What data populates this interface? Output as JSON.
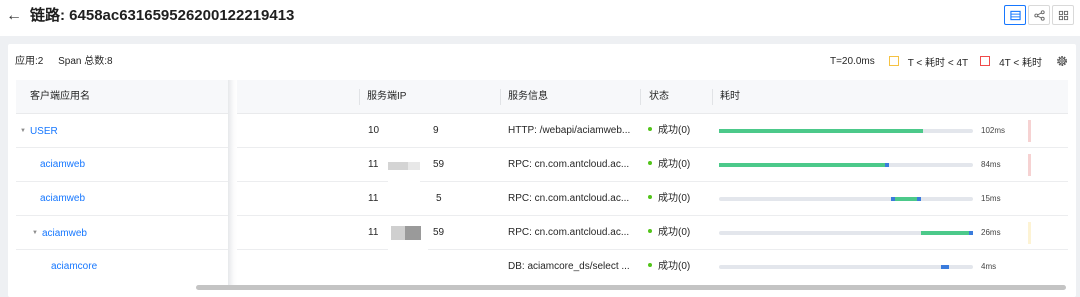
{
  "header": {
    "back_icon": "arrow-left-icon",
    "title": "链路: 6458ac631659526200122219413",
    "view_buttons": [
      {
        "icon": "table-view-icon",
        "active": true
      },
      {
        "icon": "graph-view-icon",
        "active": false
      },
      {
        "icon": "grid-view-icon",
        "active": false
      }
    ]
  },
  "summary": {
    "apps": "应用:2",
    "span_count": "Span 总数:8"
  },
  "legend": {
    "t_value": "T=20.0ms",
    "warn_label": "T < 耗时 < 4T",
    "warn_color": "#f5c242",
    "alert_label": "4T < 耗时",
    "alert_color": "#f04a4a",
    "settings_icon": "gear-icon"
  },
  "table": {
    "columns": [
      "客户端应用名",
      "服务端IP",
      "服务信息",
      "状态",
      "耗时"
    ],
    "rows": [
      {
        "app": "USER",
        "expandable": true,
        "indent": 0,
        "ip_prefix": "10",
        "ip_suffix": "9",
        "service": "HTTP: /webapi/aciamweb...",
        "status": "成功(0)",
        "duration": "102ms"
      },
      {
        "app": "aciamweb",
        "expandable": false,
        "indent": 1,
        "ip_prefix": "11",
        "ip_suffix": "59",
        "service": "RPC: cn.com.antcloud.ac...",
        "status": "成功(0)",
        "duration": "84ms"
      },
      {
        "app": "aciamweb",
        "expandable": false,
        "indent": 1,
        "ip_prefix": "11",
        "ip_suffix": "5",
        "service": "RPC: cn.com.antcloud.ac...",
        "status": "成功(0)",
        "duration": "15ms"
      },
      {
        "app": "aciamweb",
        "expandable": true,
        "indent": 1,
        "ip_prefix": "11",
        "ip_suffix": "59",
        "service": "RPC: cn.com.antcloud.ac...",
        "status": "成功(0)",
        "duration": "26ms"
      },
      {
        "app": "aciamcore",
        "expandable": false,
        "indent": 2,
        "ip_prefix": "",
        "ip_suffix": "",
        "service": "DB: aciamcore_ds/select ...",
        "status": "成功(0)",
        "duration": "4ms"
      }
    ]
  },
  "colors": {
    "accent": "#1677ff",
    "success": "#52c41a",
    "bar_fill": "#4cc98a",
    "bar_mark": "#3a7bdc"
  }
}
